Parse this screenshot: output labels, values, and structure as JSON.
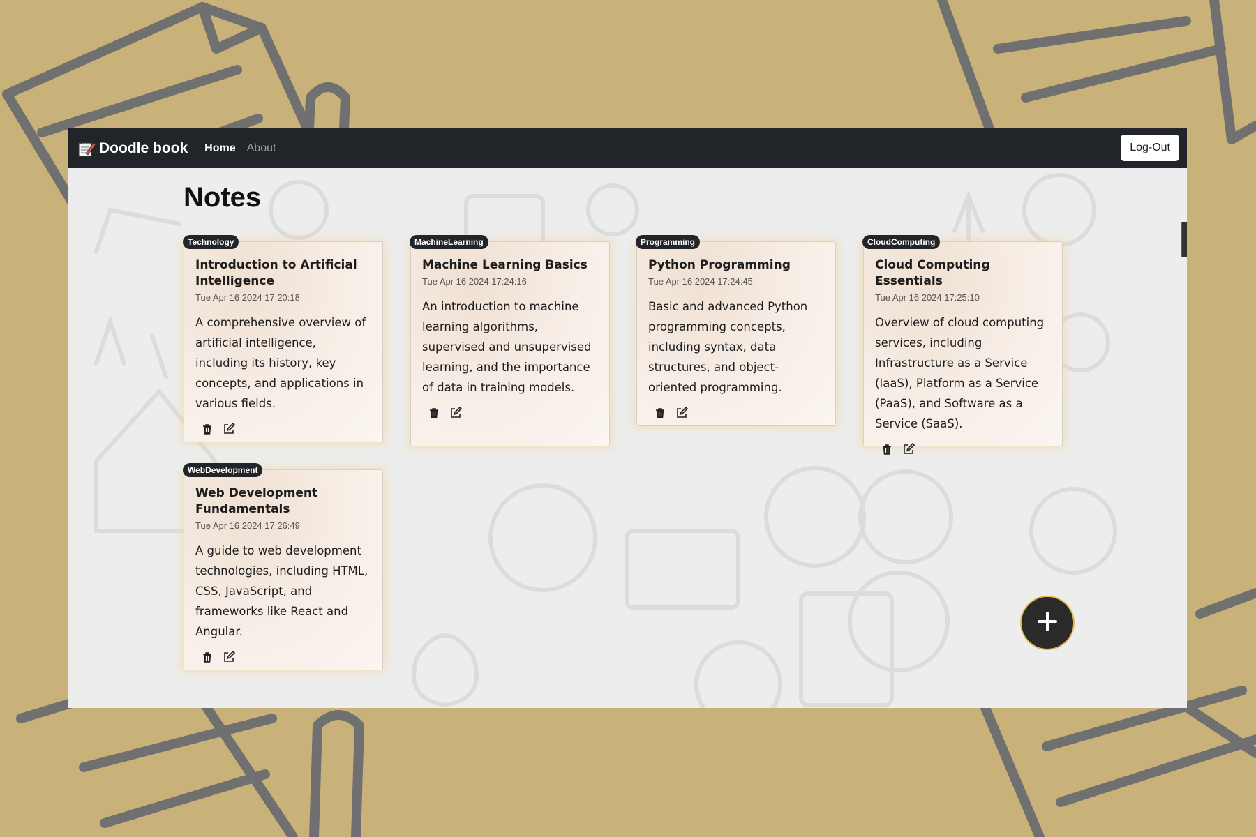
{
  "navbar": {
    "brand": "Doodle book",
    "links": [
      "Home",
      "About"
    ],
    "logout_label": "Log-Out"
  },
  "page": {
    "title": "Notes"
  },
  "notes": [
    {
      "tag": "Technology",
      "title": "Introduction to Artificial Intelligence",
      "date": "Tue Apr 16 2024 17:20:18",
      "description": "A comprehensive overview of artificial intelligence, including its history, key concepts, and applications in various fields."
    },
    {
      "tag": "MachineLearning",
      "title": "Machine Learning Basics",
      "date": "Tue Apr 16 2024 17:24:16",
      "description": "An introduction to machine learning algorithms, supervised and unsupervised learning, and the importance of data in training models."
    },
    {
      "tag": "Programming",
      "title": "Python Programming",
      "date": "Tue Apr 16 2024 17:24:45",
      "description": "Basic and advanced Python programming concepts, including syntax, data structures, and object-oriented programming."
    },
    {
      "tag": "CloudComputing",
      "title": "Cloud Computing Essentials",
      "date": "Tue Apr 16 2024 17:25:10",
      "description": "Overview of cloud computing services, including Infrastructure as a Service (IaaS), Platform as a Service (PaaS), and Software as a Service (SaaS)."
    },
    {
      "tag": "WebDevelopment",
      "title": "Web Development Fundamentals",
      "date": "Tue Apr 16 2024 17:26:49",
      "description": "A guide to web development technologies, including HTML, CSS, JavaScript, and frameworks like React and Angular."
    }
  ],
  "icons": {
    "brand": "notebook-pencil-icon",
    "delete": "trash-icon",
    "edit": "edit-icon",
    "add": "plus-icon"
  },
  "colors": {
    "navbar": "#212529",
    "outer_background": "#c9b27a",
    "fab_border": "#e3b74c"
  }
}
